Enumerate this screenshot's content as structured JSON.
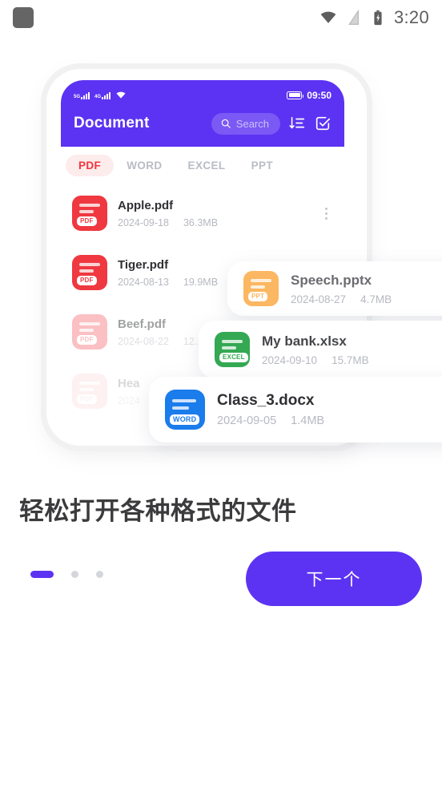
{
  "status_bar": {
    "left_icon": "app-square-icon",
    "icons": [
      "wifi-icon",
      "signal-off-icon",
      "battery-charging-icon"
    ],
    "time": "3:20"
  },
  "phone_mockup": {
    "mini_status": {
      "network_1": "5G",
      "network_2": "4G",
      "wifi_icon": "wifi-icon",
      "battery_icon": "battery-icon",
      "time": "09:50"
    },
    "app_bar": {
      "title": "Document",
      "search_placeholder": "Search",
      "search_icon": "search-icon",
      "sort_icon": "sort-icon",
      "select_icon": "check-square-icon"
    },
    "tabs": [
      {
        "label": "PDF",
        "active": true
      },
      {
        "label": "WORD",
        "active": false
      },
      {
        "label": "EXCEL",
        "active": false
      },
      {
        "label": "PPT",
        "active": false
      }
    ],
    "files": [
      {
        "name": "Apple.pdf",
        "date": "2024-09-18",
        "size": "36.3MB",
        "type": "PDF",
        "color": "#ef3840"
      },
      {
        "name": "Tiger.pdf",
        "date": "2024-08-13",
        "size": "19.9MB",
        "type": "PDF",
        "color": "#ef3840"
      },
      {
        "name": "Beef.pdf",
        "date": "2024-08-22",
        "size": "12.1MB",
        "type": "PDF",
        "color": "#f4767c"
      },
      {
        "name": "Hea",
        "date": "2024",
        "size": "",
        "type": "PDF",
        "color": "#f9b6ba"
      }
    ],
    "float_cards": [
      {
        "name": "Speech.pptx",
        "date": "2024-08-27",
        "size": "4.7MB",
        "type": "PPT",
        "color": "#f9b койка"
      },
      {
        "name": "My bank.xlsx",
        "date": "2024-09-10",
        "size": "15.7MB",
        "type": "EXCEL",
        "color": "#34a853"
      },
      {
        "name": "Class_3.docx",
        "date": "2024-09-05",
        "size": "1.4MB",
        "type": "WORD",
        "color": "#1b7ceb"
      }
    ]
  },
  "onboarding": {
    "headline": "轻松打开各种格式的文件",
    "next_button": "下一个",
    "page_count": 3,
    "active_page": 1
  },
  "colors": {
    "brand_purple": "#5c33f2",
    "pdf_red": "#ef3840",
    "ppt_orange": "#fbb761",
    "excel_green": "#34a853",
    "word_blue": "#1b7ceb"
  }
}
